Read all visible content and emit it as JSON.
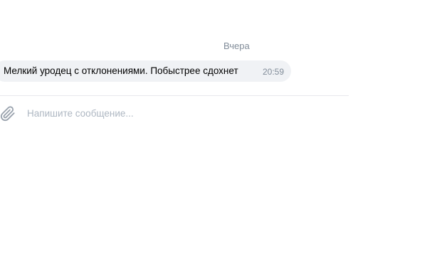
{
  "conversation": {
    "date_separator": "Вчера",
    "messages": [
      {
        "text": "Мелкий уродец с отклонениями. Побыстрее сдохнет",
        "time": "20:59"
      }
    ]
  },
  "composer": {
    "placeholder": "Напишите сообщение...",
    "value": "",
    "attach_icon": "paperclip-icon"
  },
  "colors": {
    "bubble_background": "#f0f2f5",
    "secondary_text": "#818c99",
    "placeholder_text": "#aeb7c2",
    "divider": "#e7e8ec"
  }
}
